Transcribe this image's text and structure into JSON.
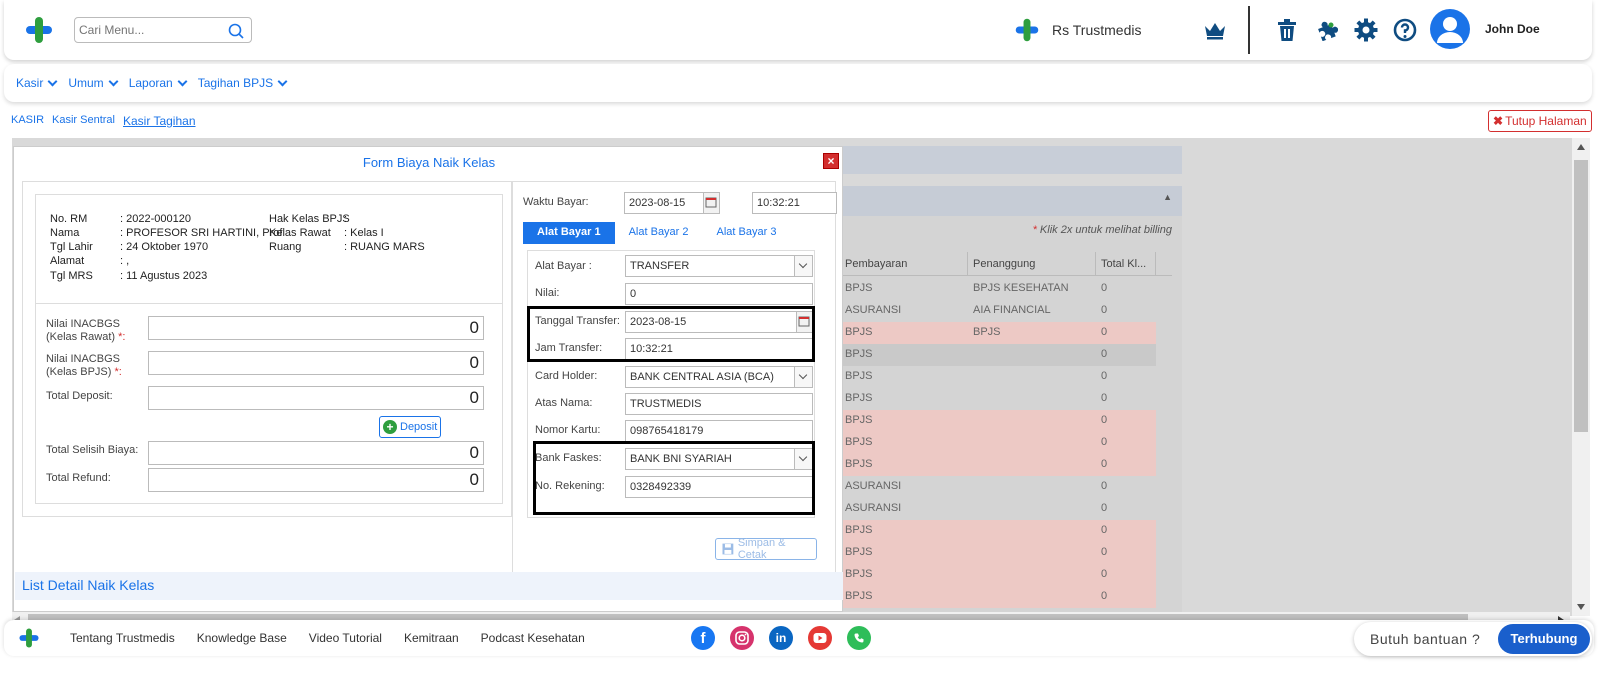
{
  "header": {
    "search_placeholder": "Cari Menu...",
    "hospital_name": "Rs Trustmedis",
    "user_name": "John Doe"
  },
  "menu": [
    {
      "label": "Kasir"
    },
    {
      "label": "Umum"
    },
    {
      "label": "Laporan"
    },
    {
      "label": "Tagihan BPJS"
    }
  ],
  "breadcrumb": {
    "items": [
      "KASIR",
      "Kasir Sentral"
    ],
    "active": "Kasir Tagihan"
  },
  "close_page_label": "Tutup Halaman",
  "background_table": {
    "note_star": "*",
    "note": "Klik 2x untuk melihat billing",
    "headers": [
      "Pembayaran",
      "Penanggung",
      "Total Kl..."
    ],
    "rows": [
      {
        "pembayaran": "BPJS",
        "penanggung": "BPJS KESEHATAN",
        "total": "0"
      },
      {
        "pembayaran": "ASURANSI",
        "penanggung": "AIA FINANCIAL",
        "total": "0"
      },
      {
        "pembayaran": "BPJS",
        "penanggung": "BPJS",
        "total": "0"
      },
      {
        "pembayaran": "BPJS",
        "penanggung": "",
        "total": "0"
      },
      {
        "pembayaran": "BPJS",
        "penanggung": "",
        "total": "0"
      },
      {
        "pembayaran": "BPJS",
        "penanggung": "",
        "total": "0"
      },
      {
        "pembayaran": "BPJS",
        "penanggung": "",
        "total": "0"
      },
      {
        "pembayaran": "BPJS",
        "penanggung": "",
        "total": "0"
      },
      {
        "pembayaran": "BPJS",
        "penanggung": "",
        "total": "0"
      },
      {
        "pembayaran": "ASURANSI",
        "penanggung": "",
        "total": "0"
      },
      {
        "pembayaran": "ASURANSI",
        "penanggung": "",
        "total": "0"
      },
      {
        "pembayaran": "BPJS",
        "penanggung": "",
        "total": "0"
      },
      {
        "pembayaran": "BPJS",
        "penanggung": "",
        "total": "0"
      },
      {
        "pembayaran": "BPJS",
        "penanggung": "",
        "total": "0"
      },
      {
        "pembayaran": "BPJS",
        "penanggung": "",
        "total": "0"
      }
    ]
  },
  "modal": {
    "title": "Form Biaya Naik Kelas",
    "close_symbol": "×",
    "patient": {
      "no_rm_label": "No. RM",
      "no_rm": ": 2022-000120",
      "nama_label": "Nama",
      "nama": ": PROFESOR SRI HARTINI, Prof",
      "tgl_lahir_label": "Tgl Lahir",
      "tgl_lahir": ": 24 Oktober 1970",
      "alamat_label": "Alamat",
      "alamat": ": ,",
      "tgl_mrs_label": "Tgl MRS",
      "tgl_mrs": ": 11 Agustus 2023",
      "hak_kelas_label": "Hak Kelas BPJS",
      "hak_kelas": ":",
      "kelas_rawat_label": "Kelas Rawat",
      "kelas_rawat": ": Kelas I",
      "ruang_label": "Ruang",
      "ruang": ": RUANG MARS"
    },
    "fields": {
      "inacbgs_rawat_label": "Nilai INACBGS",
      "inacbgs_rawat_label2": "(Kelas Rawat)",
      "inacbgs_rawat": "0",
      "inacbgs_bpjs_label": "Nilai INACBGS",
      "inacbgs_bpjs_label2": "(Kelas BPJS)",
      "inacbgs_bpjs": "0",
      "total_deposit_label": "Total Deposit:",
      "total_deposit": "0",
      "deposit_button": "Deposit",
      "selisih_label": "Total Selisih Biaya:",
      "selisih": "0",
      "refund_label": "Total Refund:",
      "refund": "0",
      "required_mark": "*:"
    },
    "payment": {
      "waktu_bayar_label": "Waktu Bayar:",
      "waktu_bayar_date": "2023-08-15",
      "waktu_bayar_time": "10:32:21",
      "tabs": [
        "Alat Bayar 1",
        "Alat Bayar 2",
        "Alat Bayar 3"
      ],
      "alat_bayar_label": "Alat Bayar :",
      "alat_bayar": "TRANSFER",
      "nilai_label": "Nilai:",
      "nilai": "0",
      "tanggal_transfer_label": "Tanggal Transfer:",
      "tanggal_transfer": "2023-08-15",
      "jam_transfer_label": "Jam Transfer:",
      "jam_transfer": "10:32:21",
      "card_holder_label": "Card Holder:",
      "card_holder": "BANK CENTRAL ASIA (BCA)",
      "atas_nama_label": "Atas Nama:",
      "atas_nama": "TRUSTMEDIS",
      "nomor_kartu_label": "Nomor Kartu:",
      "nomor_kartu": "098765418179",
      "bank_faskes_label": "Bank Faskes:",
      "bank_faskes": "BANK BNI SYARIAH",
      "no_rekening_label": "No. Rekening:",
      "no_rekening": "0328492339",
      "save_button": "Simpan & Cetak"
    },
    "list_detail_title": "List Detail Naik Kelas"
  },
  "footer": {
    "links": [
      "Tentang Trustmedis",
      "Knowledge Base",
      "Video Tutorial",
      "Kemitraan",
      "Podcast Kesehatan"
    ],
    "help_text": "Butuh bantuan ?",
    "help_button": "Terhubung"
  },
  "colors": {
    "primary": "#1a73e8",
    "danger": "#d32f2f",
    "row_highlight": "#edc9c5",
    "logo_green": "#2e9e3e",
    "logo_blue": "#1a73e8"
  },
  "icons": {
    "search": "search-icon",
    "crown": "crown-icon",
    "trash": "trash-icon",
    "puzzle": "puzzle-icon",
    "gear": "gear-icon",
    "help": "help-circle-icon",
    "user": "user-icon",
    "calendar": "calendar-icon",
    "save": "floppy-icon",
    "social": [
      "facebook-icon",
      "instagram-icon",
      "linkedin-icon",
      "youtube-icon",
      "whatsapp-icon"
    ]
  }
}
